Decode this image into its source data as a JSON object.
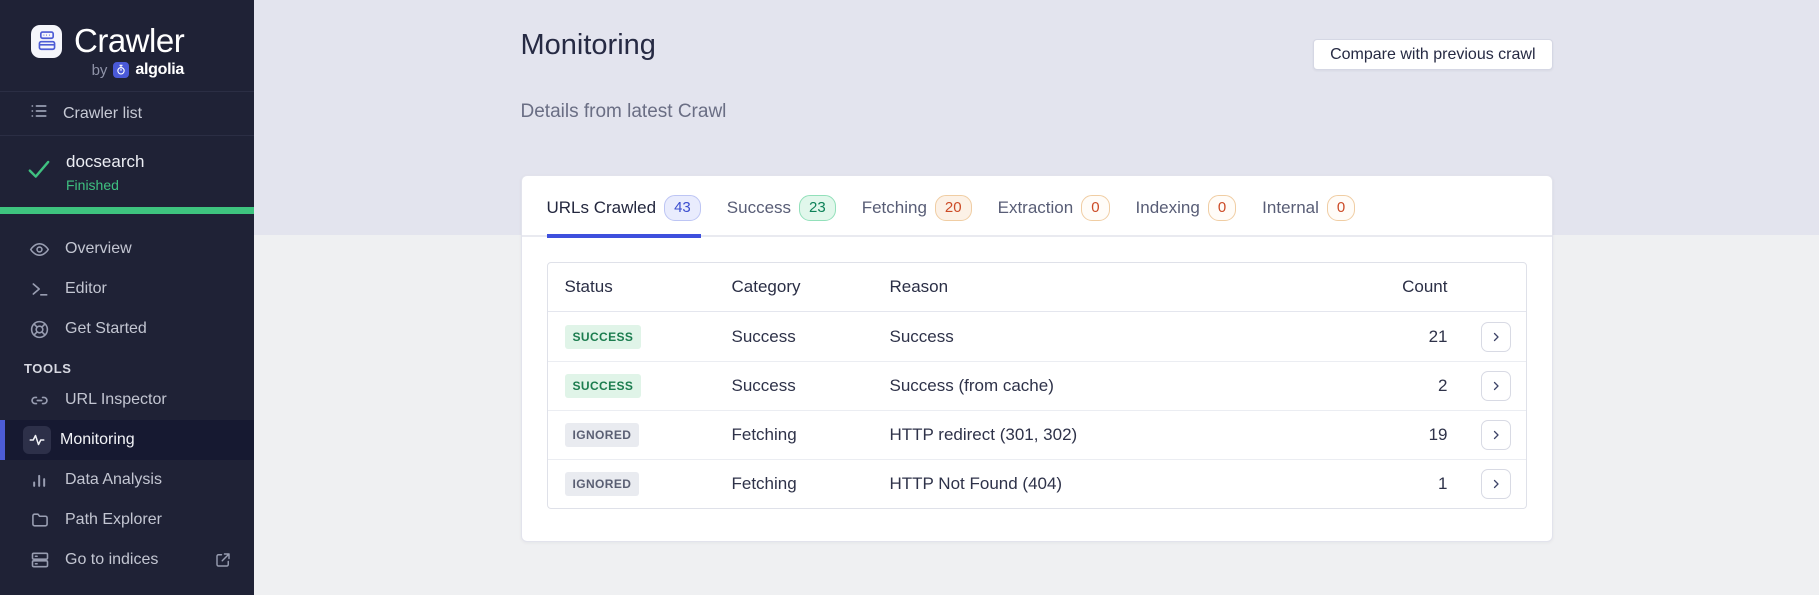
{
  "colors": {
    "sidebar_bg": "#1f2236",
    "sidebar_active_accent": "#4c5cd6",
    "success_green": "#3ec47f",
    "banner_bg": "#e3e4ee",
    "page_bg": "#eff0f2",
    "tab_accent_indigo": "#3e50dd",
    "badge_indigo_text": "#3c4ecf",
    "badge_green_text": "#0e8259",
    "badge_orange_text": "#cc4b27",
    "status_success_text": "#1c7d4f",
    "status_ignored_text": "#5a5f73"
  },
  "icons": {
    "logo": "crawler-logo-icon",
    "brand": "algolia-stopwatch-icon",
    "crawler_list": "list-icon",
    "crawl_status": "check-icon",
    "external": "external-link-icon",
    "row_action": "chevron-right-icon"
  },
  "sidebar": {
    "logo": {
      "title": "Crawler",
      "by": "by",
      "brand": "algolia"
    },
    "crawler_list_label": "Crawler list",
    "crawler": {
      "name": "docsearch",
      "status": "Finished"
    },
    "section_label": "TOOLS",
    "nav": [
      {
        "label": "Overview",
        "icon": "eye-icon"
      },
      {
        "label": "Editor",
        "icon": "terminal-icon"
      },
      {
        "label": "Get Started",
        "icon": "lifebuoy-icon"
      },
      {
        "label": "URL Inspector",
        "icon": "link-icon"
      },
      {
        "label": "Monitoring",
        "icon": "activity-icon",
        "active": true
      },
      {
        "label": "Data Analysis",
        "icon": "bar-chart-icon"
      },
      {
        "label": "Path Explorer",
        "icon": "folder-icon"
      },
      {
        "label": "Go to indices",
        "icon": "indices-icon",
        "external": true
      }
    ]
  },
  "header": {
    "title": "Monitoring",
    "subtitle": "Details from latest Crawl",
    "compare_button": "Compare with previous crawl"
  },
  "tabs": [
    {
      "label": "URLs Crawled",
      "count": "43",
      "variant": "indigo",
      "active": true
    },
    {
      "label": "Success",
      "count": "23",
      "variant": "green",
      "active": false
    },
    {
      "label": "Fetching",
      "count": "20",
      "variant": "orange",
      "active": false
    },
    {
      "label": "Extraction",
      "count": "0",
      "variant": "orange-zero",
      "active": false
    },
    {
      "label": "Indexing",
      "count": "0",
      "variant": "orange-zero",
      "active": false
    },
    {
      "label": "Internal",
      "count": "0",
      "variant": "orange-zero",
      "active": false
    }
  ],
  "table": {
    "headers": {
      "status": "Status",
      "category": "Category",
      "reason": "Reason",
      "count": "Count"
    },
    "rows": [
      {
        "status": "SUCCESS",
        "variant": "success",
        "category": "Success",
        "reason": "Success",
        "count": "21"
      },
      {
        "status": "SUCCESS",
        "variant": "success",
        "category": "Success",
        "reason": "Success (from cache)",
        "count": "2"
      },
      {
        "status": "IGNORED",
        "variant": "ignored",
        "category": "Fetching",
        "reason": "HTTP redirect (301, 302)",
        "count": "19"
      },
      {
        "status": "IGNORED",
        "variant": "ignored",
        "category": "Fetching",
        "reason": "HTTP Not Found (404)",
        "count": "1"
      }
    ]
  }
}
